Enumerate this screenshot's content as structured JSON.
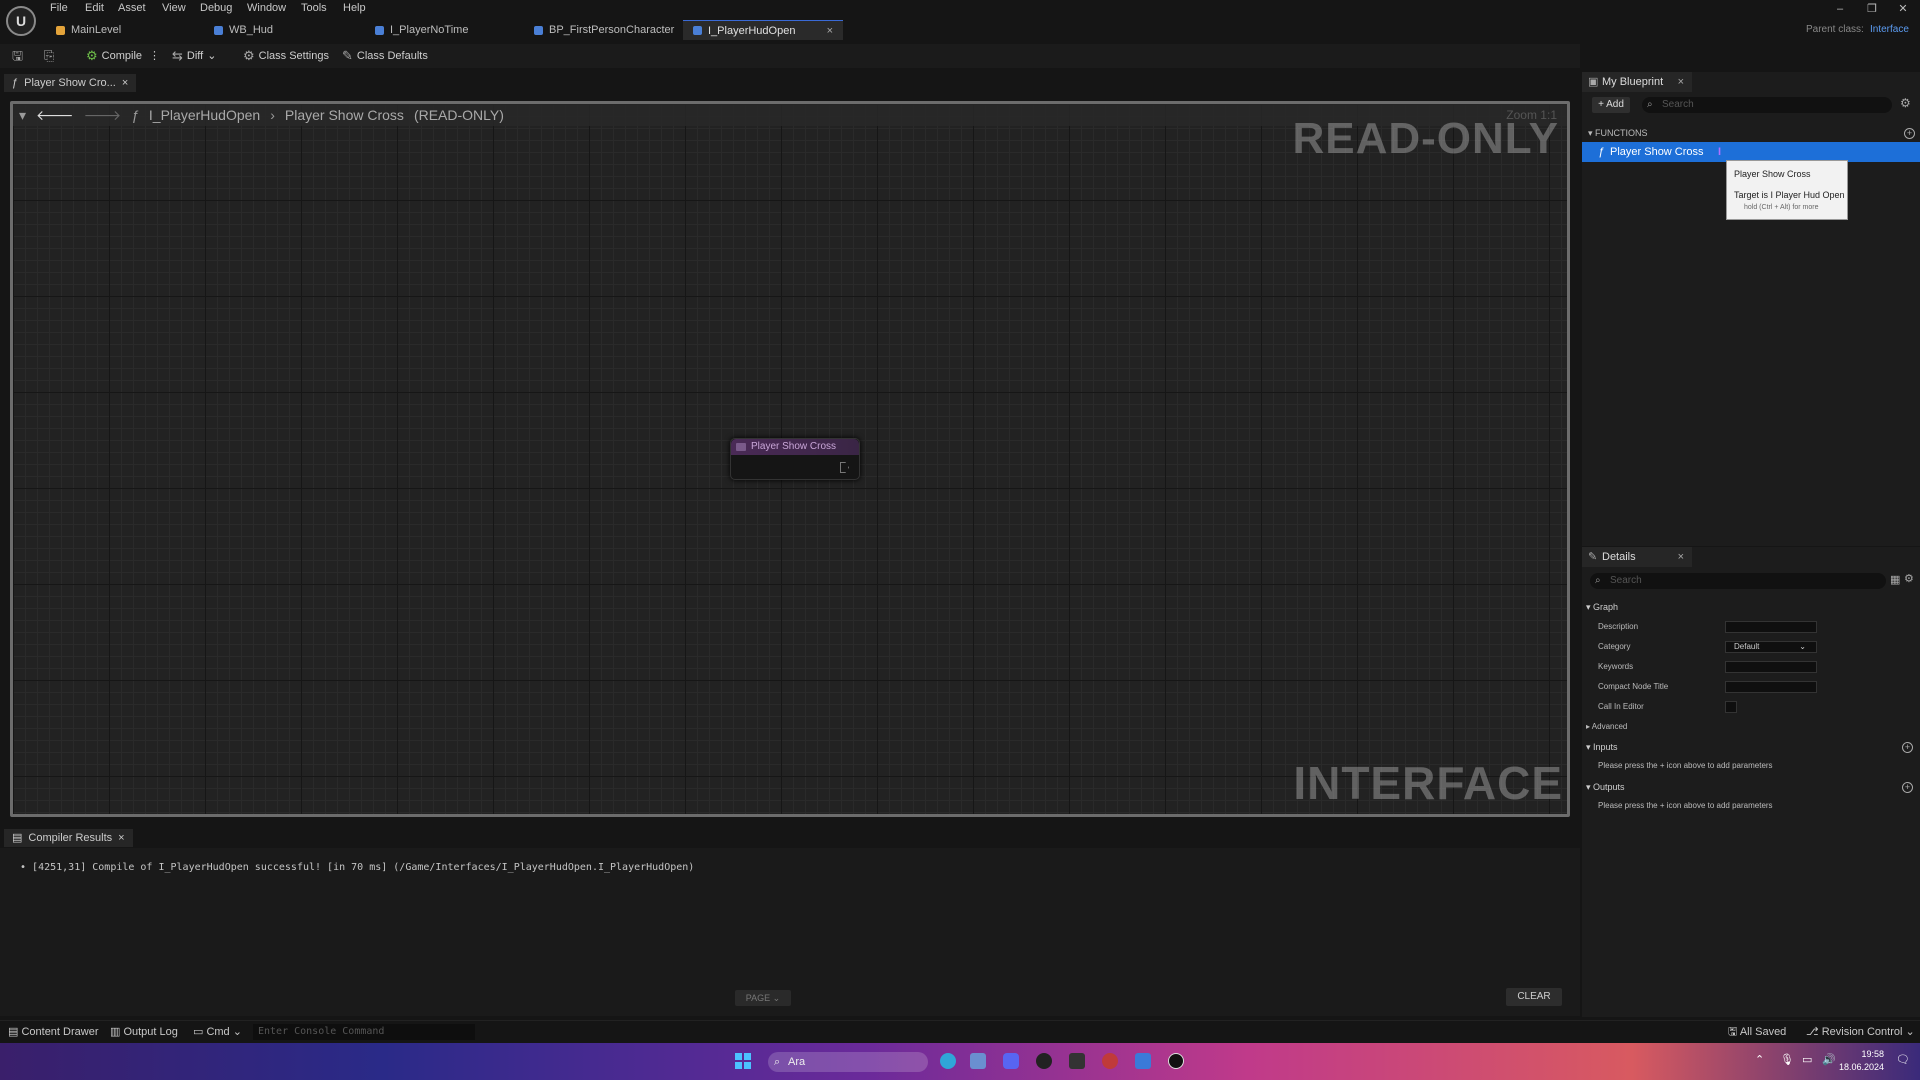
{
  "menu": [
    "File",
    "Edit",
    "Asset",
    "View",
    "Debug",
    "Window",
    "Tools",
    "Help"
  ],
  "doc_tabs": [
    {
      "label": "MainLevel",
      "color": "#e3a33a"
    },
    {
      "label": "WB_Hud",
      "color": "#4a7fd6"
    },
    {
      "label": "I_PlayerNoTime",
      "color": "#4a7fd6"
    },
    {
      "label": "BP_FirstPersonCharacter",
      "color": "#4a7fd6"
    },
    {
      "label": "I_PlayerHudOpen",
      "color": "#4a7fd6",
      "close": "×"
    }
  ],
  "parent_class": {
    "label": "Parent class:",
    "value": "Interface"
  },
  "toolbar": {
    "compile": "Compile",
    "diff": "Diff",
    "class_settings": "Class Settings",
    "class_defaults": "Class Defaults"
  },
  "graph": {
    "tab_label": "Player Show Cro...",
    "tab_close": "×",
    "breadcrumb_root": "I_PlayerHudOpen",
    "breadcrumb_sep": "›",
    "breadcrumb_current": "Player Show Cross",
    "readonly_tag": "(READ-ONLY)",
    "zoom": "Zoom 1:1",
    "watermark_top": "READ-ONLY",
    "watermark_bottom": "INTERFACE",
    "node_title": "Player Show Cross"
  },
  "compiler": {
    "tab_label": "Compiler Results",
    "tab_close": "×",
    "message": "[4251,31] Compile of I_PlayerHudOpen successful! [in 70 ms] (/Game/Interfaces/I_PlayerHudOpen.I_PlayerHudOpen)",
    "page_label": "PAGE ⌄",
    "clear_label": "CLEAR"
  },
  "my_blueprint": {
    "tab_label": "My Blueprint",
    "tab_close": "×",
    "add_label": "+ Add",
    "search_placeholder": "Search",
    "functions_header": "FUNCTIONS",
    "function_item": "Player Show Cross",
    "tooltip_title": "Player Show Cross",
    "tooltip_target": "Target is I Player Hud Open",
    "tooltip_hint": "hold (Ctrl + Alt) for more"
  },
  "details": {
    "tab_label": "Details",
    "tab_close": "×",
    "search_placeholder": "Search",
    "graph_section": "Graph",
    "description": "Description",
    "category": "Category",
    "category_value": "Default",
    "keywords": "Keywords",
    "compact_title": "Compact Node Title",
    "call_in_editor": "Call In Editor",
    "advanced": "Advanced",
    "inputs": "Inputs",
    "inputs_hint": "Please press the + icon above to add parameters",
    "outputs": "Outputs",
    "outputs_hint": "Please press the + icon above to add parameters"
  },
  "statusbar": {
    "content_drawer": "Content Drawer",
    "output_log": "Output Log",
    "cmd": "Cmd",
    "console_placeholder": "Enter Console Command",
    "all_saved": "All Saved",
    "revision_control": "Revision Control"
  },
  "taskbar": {
    "search": "Ara",
    "time": "19:58",
    "date": "18.06.2024"
  }
}
